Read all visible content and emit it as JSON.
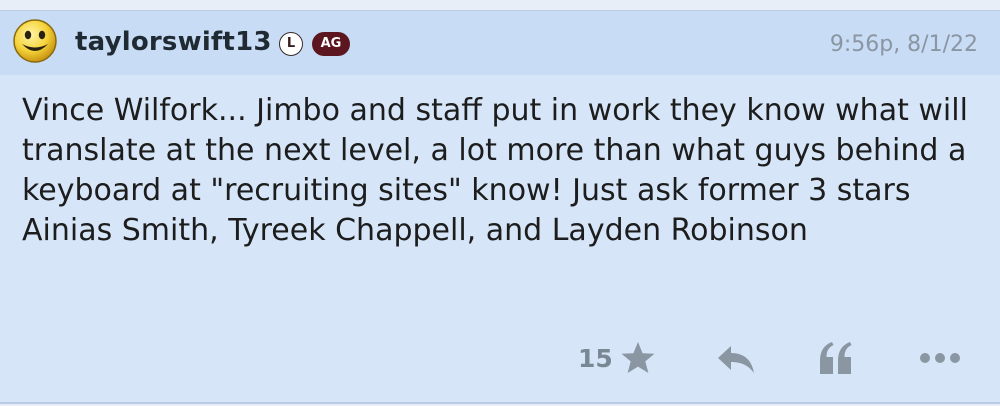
{
  "post": {
    "avatar_icon": "smiley-face-icon",
    "username": "taylorswift13",
    "badges": {
      "l_label": "L",
      "ag_label": "AG",
      "ag_color": "#5b1620"
    },
    "timestamp": "9:56p, 8/1/22",
    "body": "Vince Wilfork... Jimbo and staff put in work they know what will translate at the next level, a lot more than what guys behind a keyboard at \"recruiting sites\" know! Just ask former 3 stars Ainias Smith, Tyreek Chappell, and Layden Robinson",
    "actions": {
      "like_count": "15",
      "like_icon": "star-icon",
      "reply_icon": "reply-icon",
      "quote_icon": "quote-icon",
      "more_icon": "more-icon"
    }
  },
  "colors": {
    "header_bg": "#c8dcf5",
    "body_bg": "#d6e6f8",
    "icon_gray": "#8a96a2"
  }
}
